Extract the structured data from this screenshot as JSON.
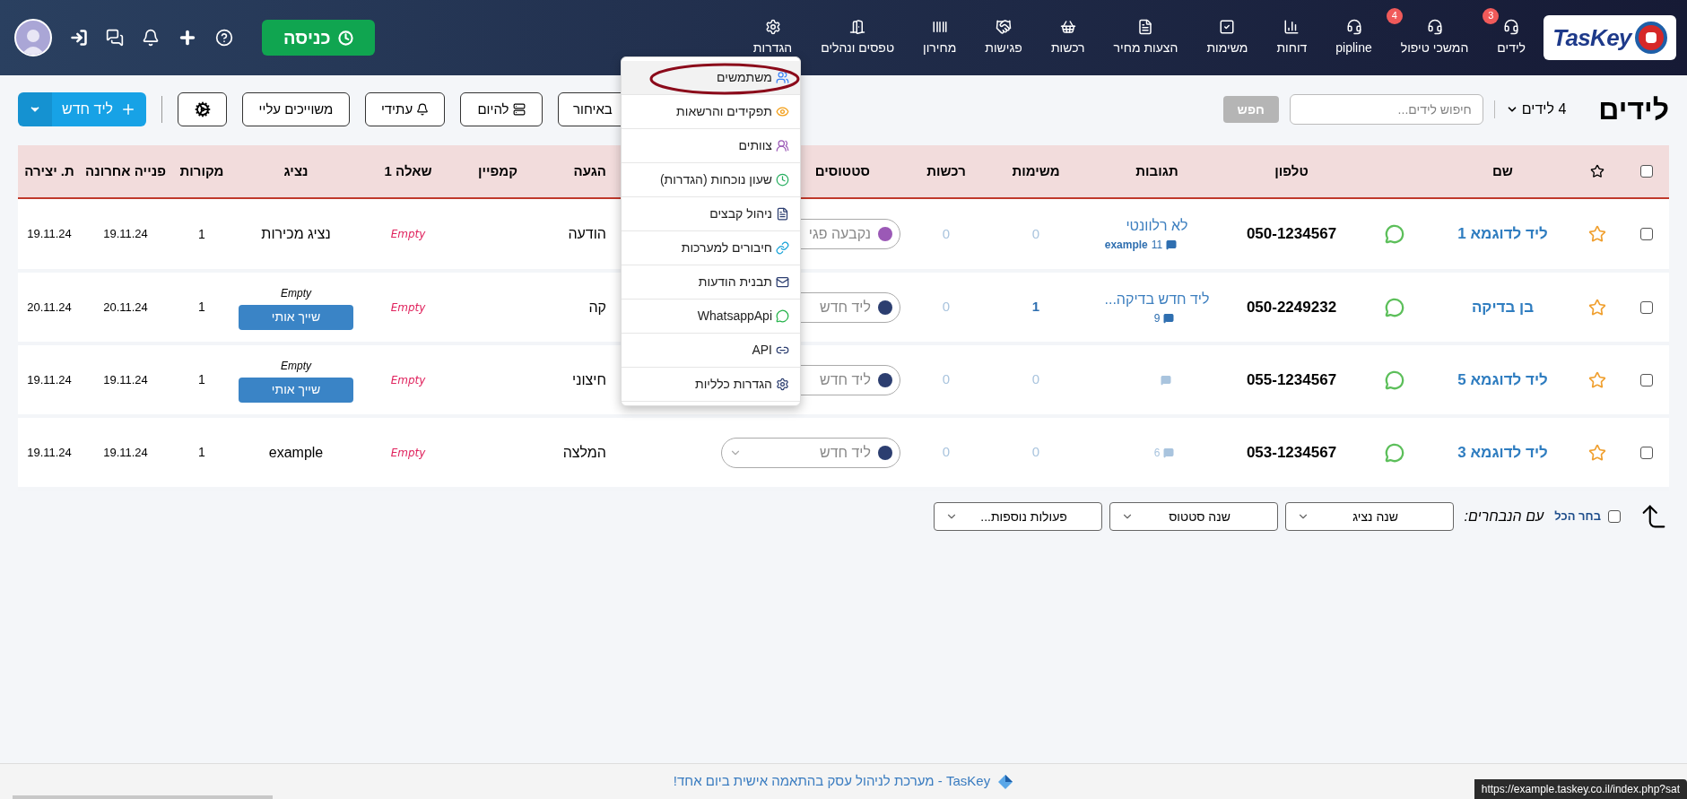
{
  "header": {
    "logo": "TasKey",
    "nav": [
      {
        "label": "לידים",
        "badge": "3"
      },
      {
        "label": "המשכי טיפול",
        "badge": "4"
      },
      {
        "label": "pipline"
      },
      {
        "label": "דוחות"
      },
      {
        "label": "משימות"
      },
      {
        "label": "הצעות מחיר"
      },
      {
        "label": "רכשות"
      },
      {
        "label": "פגישות"
      },
      {
        "label": "מחירון"
      },
      {
        "label": "טפסים ונהלים"
      },
      {
        "label": "הגדרות"
      }
    ],
    "clock_in": "כניסה"
  },
  "toolbar": {
    "title": "לידים",
    "count": "4 לידים",
    "search_placeholder": "חיפוש לידים...",
    "search_button": "חפש",
    "filters": [
      "באיחור",
      "להיום",
      "עתידי",
      "משוייכים עליי"
    ],
    "new_lead": "ליד חדש"
  },
  "settings_menu": [
    {
      "label": "משתמשים",
      "selected": true
    },
    {
      "label": "תפקידים והרשאות",
      "selected": false
    },
    {
      "label": "צוותים",
      "selected": false
    },
    {
      "label": "שעון נוכחות (הגדרות)",
      "selected": false
    },
    {
      "label": "ניהול קבצים",
      "selected": false
    },
    {
      "label": "חיבורים למערכות",
      "selected": false
    },
    {
      "label": "תבנית הודעות",
      "selected": false
    },
    {
      "label": "WhatsappApi",
      "selected": false
    },
    {
      "label": "API",
      "selected": false
    },
    {
      "label": "הגדרות כלליות",
      "selected": false
    }
  ],
  "table": {
    "all_checked": false,
    "columns": [
      "שם",
      "טלפון",
      "תגובות",
      "משימות",
      "רכשות",
      "סטטוסים",
      "הגעה",
      "קמפיין",
      "שאלה 1",
      "נציג",
      "מקורות",
      "פנייה אחרונה",
      "ת. יצירה"
    ],
    "rows": [
      {
        "checked": false,
        "starred": false,
        "name": "ליד לדוגמא 1",
        "phone": "050-1234567",
        "comment": "לא רלוונטי",
        "comment_count": "11",
        "comment_author": "example",
        "comments_faded": false,
        "tasks": "0",
        "tasks_active": false,
        "purchases": "0",
        "status": "נקבעה פגי",
        "color": "#9b59b6",
        "source": "הודעה",
        "question": "Empty",
        "rep": {
          "kind": "name",
          "text": "נציג מכירות"
        },
        "sources": "1",
        "last_contact": "19.11.24",
        "created": "19.11.24"
      },
      {
        "checked": false,
        "starred": false,
        "name": "בן בדיקה",
        "phone": "050-2249232",
        "comment": "ליד חדש בדיקה...",
        "comment_count": "9",
        "comments_faded": false,
        "tasks": "1",
        "tasks_active": true,
        "purchases": "0",
        "status": "ליד חדש",
        "color": "#2c3e70",
        "source": "קה",
        "question": "Empty",
        "rep": {
          "kind": "assign",
          "text": "Empty",
          "button": "שייך אותי"
        },
        "sources": "1",
        "last_contact": "20.11.24",
        "created": "20.11.24"
      },
      {
        "checked": false,
        "starred": false,
        "name": "ליד לדוגמא 5",
        "phone": "055-1234567",
        "comments_faded": true,
        "tasks": "0",
        "tasks_active": false,
        "purchases": "0",
        "status": "ליד חדש",
        "color": "#2c3e70",
        "source": "חיצוני",
        "question": "Empty",
        "rep": {
          "kind": "assign",
          "text": "Empty",
          "button": "שייך אותי"
        },
        "sources": "1",
        "last_contact": "19.11.24",
        "created": "19.11.24"
      },
      {
        "checked": false,
        "starred": false,
        "name": "ליד לדוגמא 3",
        "phone": "053-1234567",
        "comment_count": "6",
        "comments_faded": true,
        "tasks": "0",
        "tasks_active": false,
        "purchases": "0",
        "status": "ליד חדש",
        "color": "#2c3e70",
        "source": "המלצה",
        "question": "Empty",
        "rep": {
          "kind": "name",
          "text": "example"
        },
        "sources": "1",
        "last_contact": "19.11.24",
        "created": "19.11.24"
      }
    ]
  },
  "bulk": {
    "select_all": "בחר הכל",
    "select_all_checked": false,
    "with_selected": "עם הנבחרים:",
    "actions": [
      "שנה נציג",
      "שנה סטטוס",
      "פעולות נוספות..."
    ]
  },
  "footer": {
    "text": "TasKey - מערכת לניהול עסק בהתאמה אישית ביום אחד!"
  },
  "status_url": "https://example.taskey.co.il/index.php?sat"
}
